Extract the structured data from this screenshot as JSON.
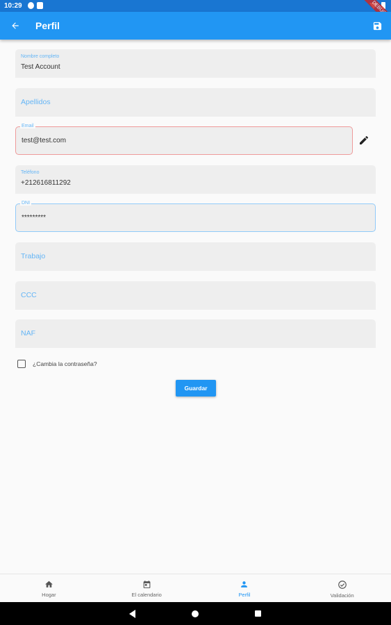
{
  "status_bar": {
    "time": "10:29",
    "debug_label": "DEBUG"
  },
  "app_bar": {
    "title": "Perfil"
  },
  "form": {
    "nombre": {
      "label": "Nombre completo",
      "value": "Test Account"
    },
    "apellidos": {
      "placeholder": "Apellidos"
    },
    "email": {
      "label": "Email",
      "value": "test@test.com"
    },
    "telefono": {
      "label": "Teléfono",
      "value": "+212616811292"
    },
    "dni": {
      "label": "DNI",
      "value": "*********"
    },
    "trabajo": {
      "placeholder": "Trabajo"
    },
    "ccc": {
      "placeholder": "CCC"
    },
    "naf": {
      "placeholder": "NAF"
    },
    "change_password": {
      "label": "¿Cambia la contraseña?",
      "checked": false
    },
    "save_label": "Guardar"
  },
  "bottom_nav": {
    "items": [
      {
        "label": "Hogar",
        "icon": "home-icon",
        "active": false
      },
      {
        "label": "El calendario",
        "icon": "calendar-icon",
        "active": false
      },
      {
        "label": "Perfil",
        "icon": "person-icon",
        "active": true
      },
      {
        "label": "Validación",
        "icon": "check-circle-icon",
        "active": false
      }
    ]
  },
  "colors": {
    "primary": "#2196f3",
    "status_bar": "#1976d2",
    "error_outline": "#ef9a9a",
    "focus_outline": "#90caf9"
  }
}
